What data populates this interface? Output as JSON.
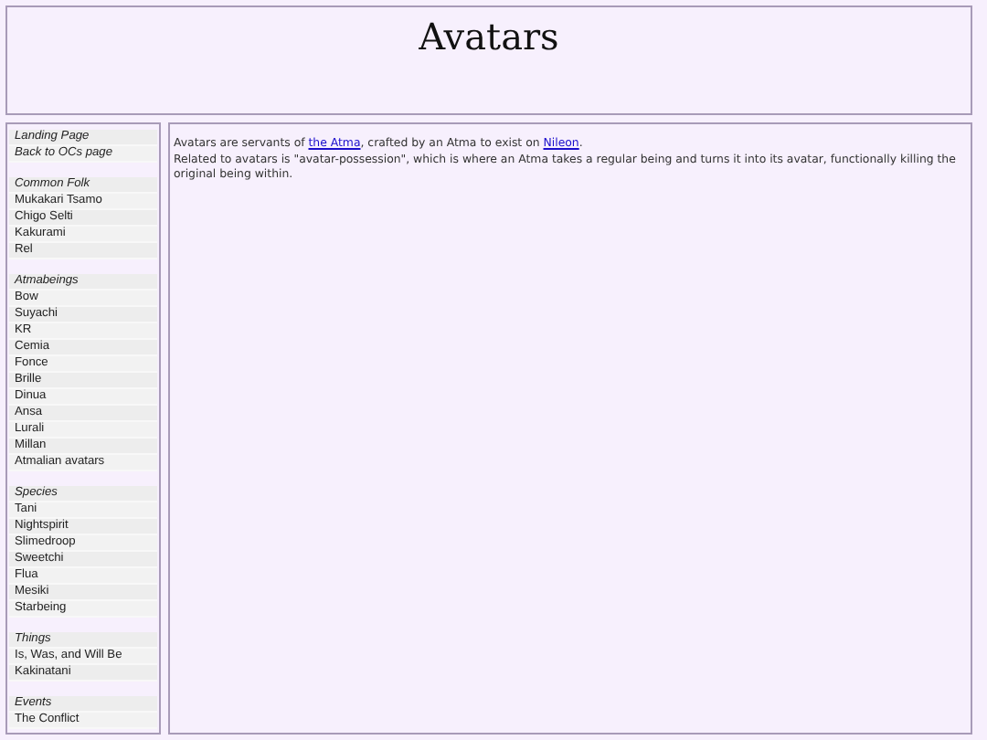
{
  "header": {
    "title": "Avatars"
  },
  "sidebar": {
    "groups": [
      {
        "items": [
          {
            "kind": "heading",
            "label": "Landing Page"
          },
          {
            "kind": "heading",
            "label": "Back to OCs page"
          }
        ]
      },
      {
        "items": [
          {
            "kind": "heading",
            "label": "Common Folk"
          },
          {
            "kind": "item",
            "label": "Mukakari Tsamo"
          },
          {
            "kind": "item",
            "label": "Chigo Selti"
          },
          {
            "kind": "item",
            "label": "Kakurami"
          },
          {
            "kind": "item",
            "label": "Rel"
          }
        ]
      },
      {
        "items": [
          {
            "kind": "heading",
            "label": "Atmabeings"
          },
          {
            "kind": "item",
            "label": "Bow"
          },
          {
            "kind": "item",
            "label": "Suyachi"
          },
          {
            "kind": "item",
            "label": "KR"
          },
          {
            "kind": "item",
            "label": "Cemia"
          },
          {
            "kind": "item",
            "label": "Fonce"
          },
          {
            "kind": "item",
            "label": "Brille"
          },
          {
            "kind": "item",
            "label": "Dinua"
          },
          {
            "kind": "item",
            "label": "Ansa"
          },
          {
            "kind": "item",
            "label": "Lurali"
          },
          {
            "kind": "item",
            "label": "Millan"
          },
          {
            "kind": "item",
            "label": "Atmalian avatars"
          }
        ]
      },
      {
        "items": [
          {
            "kind": "heading",
            "label": "Species"
          },
          {
            "kind": "item",
            "label": "Tani"
          },
          {
            "kind": "item",
            "label": "Nightspirit"
          },
          {
            "kind": "item",
            "label": "Slimedroop"
          },
          {
            "kind": "item",
            "label": "Sweetchi"
          },
          {
            "kind": "item",
            "label": "Flua"
          },
          {
            "kind": "item",
            "label": "Mesiki"
          },
          {
            "kind": "item",
            "label": "Starbeing"
          }
        ]
      },
      {
        "items": [
          {
            "kind": "heading",
            "label": "Things"
          },
          {
            "kind": "item",
            "label": "Is, Was, and Will Be"
          },
          {
            "kind": "item",
            "label": "Kakinatani"
          }
        ]
      },
      {
        "items": [
          {
            "kind": "heading",
            "label": "Events"
          },
          {
            "kind": "item",
            "label": "The Conflict"
          }
        ]
      }
    ]
  },
  "content": {
    "paragraphs": [
      [
        {
          "kind": "text",
          "text": "Avatars are servants of "
        },
        {
          "kind": "link",
          "text": "the Atma"
        },
        {
          "kind": "text",
          "text": ", crafted by an Atma to exist on "
        },
        {
          "kind": "link",
          "text": "Nileon"
        },
        {
          "kind": "text",
          "text": "."
        }
      ],
      [
        {
          "kind": "text",
          "text": "Related to avatars is \"avatar-possession\", which is where an Atma takes a regular being and turns it into its avatar, functionally killing the original being within."
        }
      ]
    ]
  }
}
